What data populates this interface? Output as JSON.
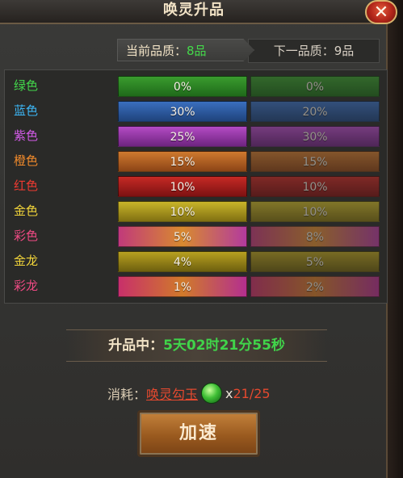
{
  "window": {
    "title": "唤灵升品"
  },
  "quality": {
    "current_label": "当前品质：",
    "current_value": "8品",
    "next_label": "下一品质：",
    "next_value": "9品"
  },
  "rows": [
    {
      "name": "绿色",
      "current": "0%",
      "next": "0%",
      "name_color": "#43d64b"
    },
    {
      "name": "蓝色",
      "current": "30%",
      "next": "20%",
      "name_color": "#3cb6f5"
    },
    {
      "name": "紫色",
      "current": "25%",
      "next": "30%",
      "name_color": "#d35be8"
    },
    {
      "name": "橙色",
      "current": "15%",
      "next": "15%",
      "name_color": "#f08a2b"
    },
    {
      "name": "红色",
      "current": "10%",
      "next": "10%",
      "name_color": "#ef3a31"
    },
    {
      "name": "金色",
      "current": "10%",
      "next": "10%",
      "name_color": "#f2d53a"
    },
    {
      "name": "彩色",
      "current": "5%",
      "next": "8%",
      "name_color": "#f04a84"
    },
    {
      "name": "金龙",
      "current": "4%",
      "next": "5%",
      "name_color": "#f2d53a"
    },
    {
      "name": "彩龙",
      "current": "1%",
      "next": "2%",
      "name_color": "#f04a84"
    }
  ],
  "upgrade": {
    "label": "升品中：",
    "value": "5天02时21分55秒"
  },
  "cost": {
    "label": "消耗：",
    "item": "唤灵勾玉",
    "multiplier": "x",
    "count": "21/25"
  },
  "button": {
    "label": "加速"
  },
  "close_label": "✕"
}
